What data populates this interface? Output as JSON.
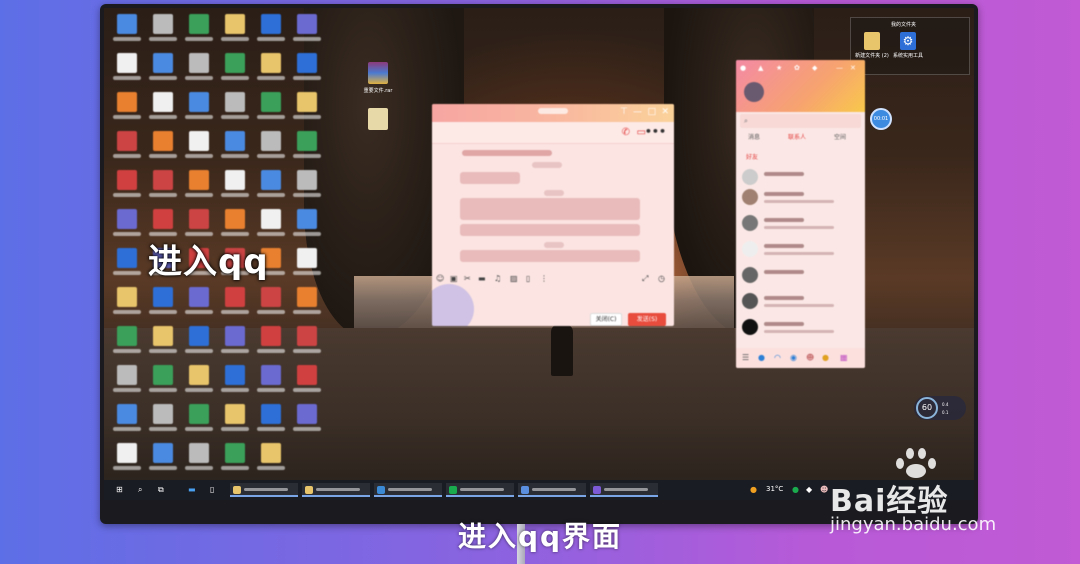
{
  "overlay_title": "进入qq",
  "caption": "进入qq界面",
  "desktop_files": [
    {
      "label": "重要文件.rar",
      "color": "#8c3a7a"
    },
    {
      "label": "",
      "color": "#e8d9a8"
    }
  ],
  "folder_widget": {
    "title": "我的文件夹",
    "items": [
      {
        "label": "新建文件夹 (2)",
        "color": "#e8c56a"
      },
      {
        "label": "系统实用工具",
        "color": "#2d6fd6"
      }
    ]
  },
  "chat_window": {
    "buttons": {
      "close": "关闭(C)",
      "send": "发送(S)"
    },
    "more_icon": "•••"
  },
  "qq_panel": {
    "tab_messages": "消息",
    "tab_contacts": "联系人",
    "tab_space": "空间",
    "section": "好友"
  },
  "time_bubble": "00:01",
  "speed": {
    "value": "60",
    "up": "0.4",
    "down": "0.1"
  },
  "taskbar": {
    "temperature": "31°C",
    "tasks": [
      {
        "color": "#e8c56a"
      },
      {
        "color": "#e8c56a"
      },
      {
        "color": "#3b8ad6"
      },
      {
        "color": "#1aab4f"
      },
      {
        "color": "#5b8fe0"
      },
      {
        "color": "#7d5bd6"
      }
    ]
  },
  "watermark": {
    "brand": "Bai经验",
    "url": "jingyan.baidu.com"
  }
}
